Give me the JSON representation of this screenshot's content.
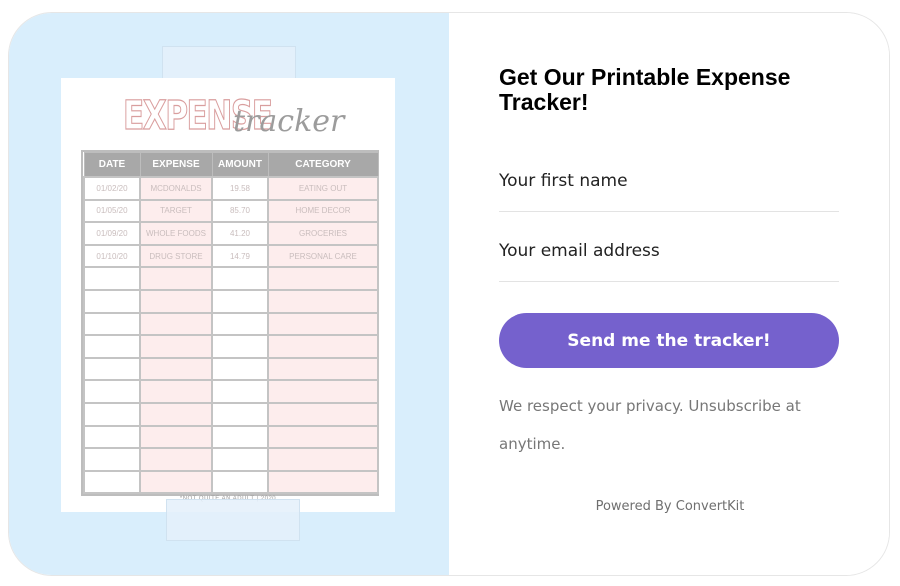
{
  "form": {
    "headline": "Get Our Printable Expense Tracker!",
    "first_name_placeholder": "Your first name",
    "email_placeholder": "Your email address",
    "submit_label": "Send me the tracker!",
    "privacy_text": "We respect your privacy. Unsubscribe at anytime.",
    "powered_by": "Powered By ConvertKit"
  },
  "tracker_image": {
    "title_bold": "EXPENSE",
    "title_script": "tracker",
    "columns": [
      "DATE",
      "EXPENSE",
      "AMOUNT",
      "CATEGORY"
    ],
    "rows": [
      [
        "01/02/20",
        "MCDONALDS",
        "19.58",
        "EATING OUT"
      ],
      [
        "01/05/20",
        "TARGET",
        "85.70",
        "HOME DECOR"
      ],
      [
        "01/09/20",
        "WHOLE FOODS",
        "41.20",
        "GROCERIES"
      ],
      [
        "01/10/20",
        "DRUG STORE",
        "14.79",
        "PERSONAL CARE"
      ]
    ],
    "empty_rows": 10,
    "footnote": "*NOT QUITE AN ADULT | 2020"
  },
  "colors": {
    "left_panel_bg": "#d9eefc",
    "button_bg": "#7561cd",
    "row_tint": "#fdeded",
    "header_gray": "#a8a8a8"
  }
}
